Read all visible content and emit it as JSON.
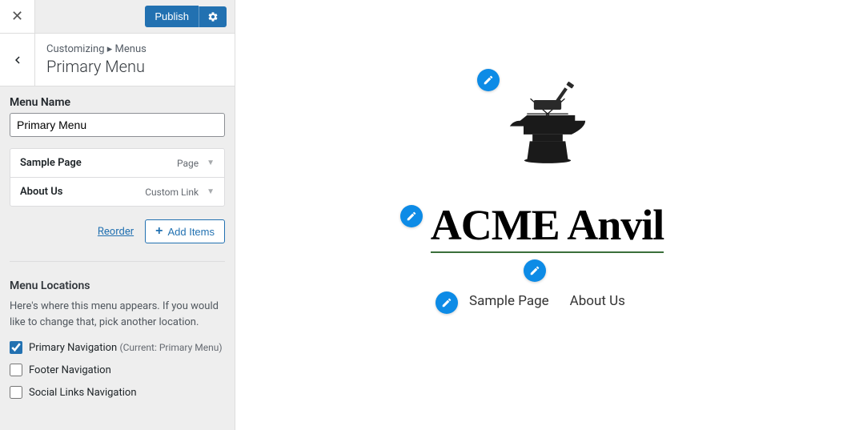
{
  "topbar": {
    "publish": "Publish"
  },
  "header": {
    "breadcrumb_prefix": "Customizing ▸",
    "breadcrumb_section": "Menus",
    "title": "Primary Menu"
  },
  "menu": {
    "name_label": "Menu Name",
    "name_value": "Primary Menu",
    "items": [
      {
        "label": "Sample Page",
        "type": "Page"
      },
      {
        "label": "About Us",
        "type": "Custom Link"
      }
    ],
    "reorder": "Reorder",
    "add_items": "Add Items"
  },
  "locations": {
    "label": "Menu Locations",
    "desc": "Here's where this menu appears. If you would like to change that, pick another location.",
    "options": [
      {
        "label": "Primary Navigation",
        "current": "(Current: Primary Menu)",
        "checked": true
      },
      {
        "label": "Footer Navigation",
        "current": "",
        "checked": false
      },
      {
        "label": "Social Links Navigation",
        "current": "",
        "checked": false
      }
    ]
  },
  "preview": {
    "site_title": "ACME Anvil",
    "nav": [
      "Sample Page",
      "About Us"
    ]
  }
}
